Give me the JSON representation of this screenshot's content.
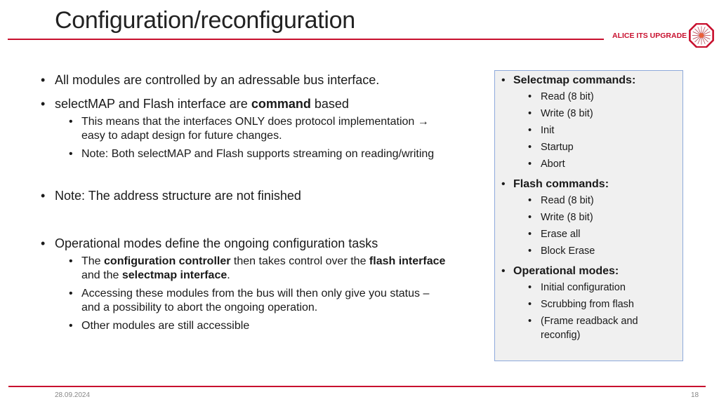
{
  "slide": {
    "title": "Configuration/reconfiguration",
    "brand": "ALICE ITS UPGRADE",
    "accent_color": "#c8102e",
    "logo_icon": "alice-logo-icon"
  },
  "main": {
    "bullets": [
      {
        "text": "All modules are controlled by an adressable bus interface."
      },
      {
        "parts": [
          "selectMAP and Flash interface are ",
          "command",
          " based"
        ],
        "sub": [
          {
            "line1": "This means that the interfaces ONLY does protocol implementation →",
            "line2": "easy to adapt design for future changes."
          },
          {
            "text": "Note: Both selectMAP and Flash supports streaming on reading/writing"
          }
        ]
      },
      {
        "text": "Note: The address structure are not finished"
      },
      {
        "text": "Operational modes define the ongoing configuration tasks",
        "sub": [
          {
            "parts": [
              "The ",
              "configuration controller",
              " then takes control over the ",
              "flash interface",
              "and the ",
              "selectmap interface",
              "."
            ]
          },
          {
            "line1": "Accessing these modules from the bus will then only give you status –",
            "line2": "and a possibility to abort the ongoing operation."
          },
          {
            "text": "Other modules are still accessible"
          }
        ]
      }
    ]
  },
  "sidebox": {
    "sections": [
      {
        "heading": "Selectmap commands:",
        "items": [
          "Read (8 bit)",
          "Write (8 bit)",
          "Init",
          "Startup",
          "Abort"
        ]
      },
      {
        "heading": "Flash commands:",
        "items": [
          "Read (8 bit)",
          "Write (8 bit)",
          "Erase all",
          "Block Erase"
        ]
      },
      {
        "heading": "Operational modes:",
        "items": [
          "Initial configuration",
          "Scrubbing from flash",
          "(Frame readback and",
          "reconfig)"
        ]
      }
    ]
  },
  "footer": {
    "date": "28.09.2024",
    "page_number": "18"
  }
}
